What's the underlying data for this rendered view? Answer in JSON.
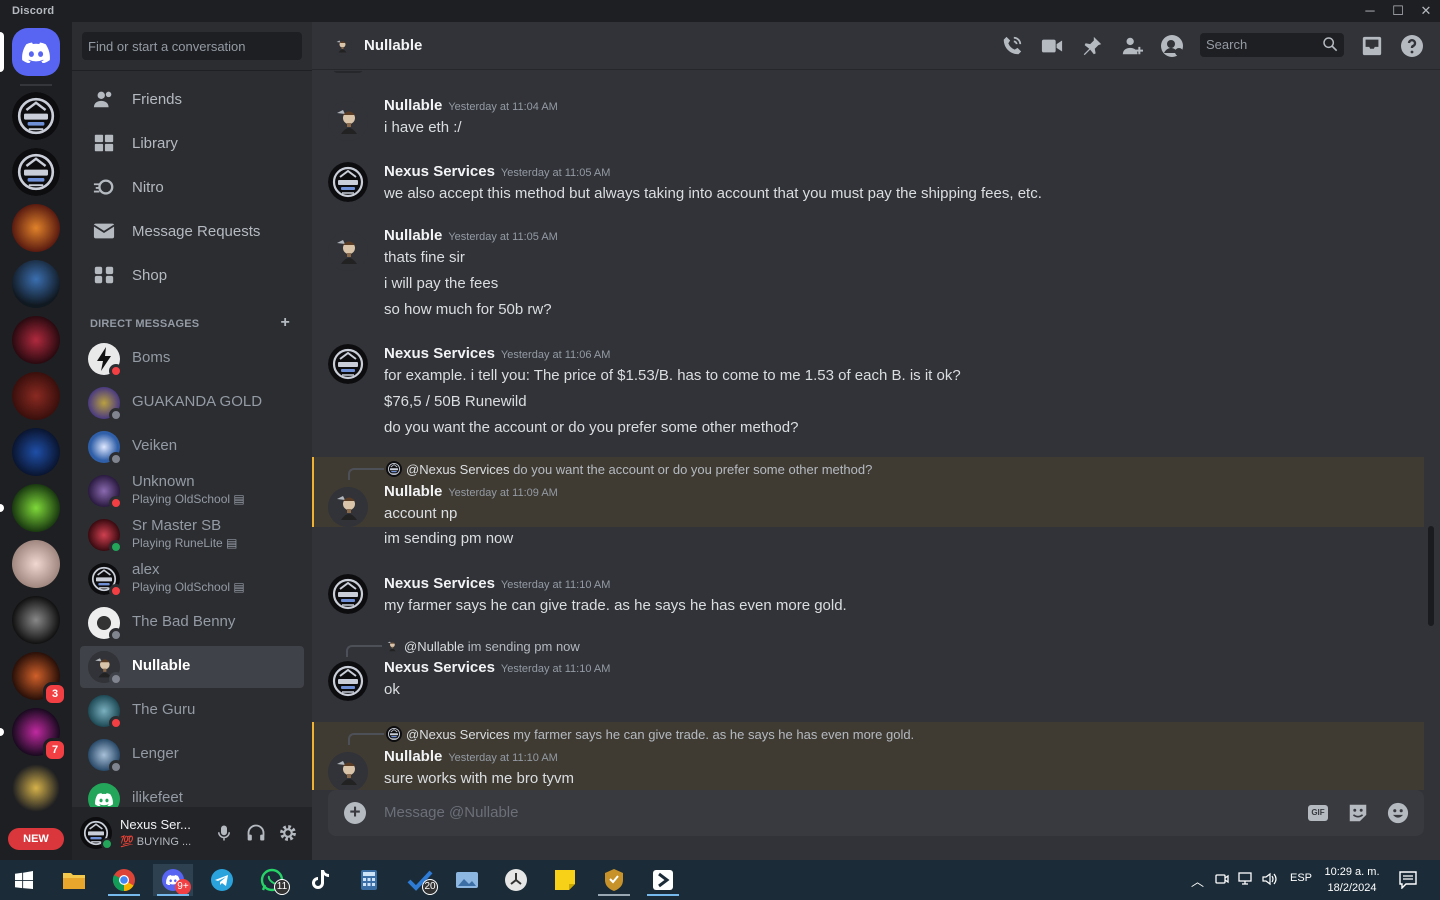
{
  "window": {
    "title": "Discord"
  },
  "search_placeholder": "Find or start a conversation",
  "nav": [
    {
      "label": "Friends",
      "icon": "friends-icon"
    },
    {
      "label": "Library",
      "icon": "library-icon"
    },
    {
      "label": "Nitro",
      "icon": "nitro-icon"
    },
    {
      "label": "Message Requests",
      "icon": "envelope-icon"
    },
    {
      "label": "Shop",
      "icon": "shop-icon"
    }
  ],
  "dm_header": "DIRECT MESSAGES",
  "dms": [
    {
      "name": "Boms",
      "status": "dnd",
      "avatar_color": "#d9dadc"
    },
    {
      "name": "GUAKANDA GOLD",
      "status": "offline",
      "avatar_color": "#6a5a9c"
    },
    {
      "name": "Veiken",
      "status": "offline",
      "avatar_color": "#2f5fa8"
    },
    {
      "name": "Unknown",
      "activity": "Playing OldSchool",
      "status": "dnd",
      "avatar_color": "#4b3a6b"
    },
    {
      "name": "Sr Master SB",
      "activity": "Playing RuneLite",
      "status": "online",
      "avatar_color": "#8a2530"
    },
    {
      "name": "alex",
      "activity": "Playing OldSchool",
      "status": "dnd",
      "avatar_color": "#3c3f55"
    },
    {
      "name": "The Bad Benny",
      "status": "offline",
      "avatar_color": "#e6e6e6"
    },
    {
      "name": "Nullable",
      "status": "offline",
      "avatar_color": "#3a3c42"
    },
    {
      "name": "The Guru",
      "status": "dnd",
      "avatar_color": "#2c5f6a"
    },
    {
      "name": "Lenger",
      "status": "offline",
      "avatar_color": "#4a6a8a"
    },
    {
      "name": "ilikefeet",
      "status": "offline",
      "avatar_color": "#23a55a"
    }
  ],
  "user": {
    "name": "Nexus Ser...",
    "status": "💯 BUYING ..."
  },
  "guild_badges": [
    "3",
    "7"
  ],
  "new_label": "NEW",
  "channel": {
    "name": "Nullable",
    "search": "Search"
  },
  "messages": [
    {
      "author": "Nullable",
      "time": "Yesterday at 11:04 AM",
      "lines": [
        "i have eth :/"
      ]
    },
    {
      "author": "Nexus Services",
      "time": "Yesterday at 11:05 AM",
      "lines": [
        "we also accept this method but always taking into account that you must pay the shipping fees, etc."
      ]
    },
    {
      "author": "Nullable",
      "time": "Yesterday at 11:05 AM",
      "lines": [
        "thats fine sir",
        "i will pay the fees",
        "so how much for 50b rw?"
      ]
    },
    {
      "author": "Nexus Services",
      "time": "Yesterday at 11:06 AM",
      "lines": [
        "for example. i tell you: The price of $1.53/B. has to come to me 1.53 of each B. is it ok?",
        "$76,5 / 50B Runewild",
        "do you want the account or do you prefer some other method?"
      ]
    },
    {
      "author": "Nullable",
      "time": "Yesterday at 11:09 AM",
      "reply_to": "@Nexus Services",
      "reply_text": "do you want the account or do you prefer some other method?",
      "lines": [
        "account np",
        "im sending pm now"
      ]
    },
    {
      "author": "Nexus Services",
      "time": "Yesterday at 11:10 AM",
      "lines": [
        "my farmer says he can give trade. as he says he has even more gold."
      ]
    },
    {
      "author": "Nexus Services",
      "time": "Yesterday at 11:10 AM",
      "reply_to": "@Nullable",
      "reply_text": "im sending pm now",
      "lines": [
        "ok"
      ]
    },
    {
      "author": "Nullable",
      "time": "Yesterday at 11:10 AM",
      "reply_to": "@Nexus Services",
      "reply_text": "my farmer says he can give trade. as he says he has even more gold.",
      "lines": [
        "sure works with me bro tyvm"
      ]
    }
  ],
  "composer": {
    "placeholder": "Message @Nullable",
    "gif": "GIF"
  },
  "taskbar": {
    "badges": {
      "chat": "9+",
      "whatsapp": "11",
      "todo": "20"
    },
    "lang": "ESP",
    "time": "10:29 a. m.",
    "date": "18/2/2024"
  },
  "colors": {
    "accent": "#5865f2",
    "dnd": "#f23f43",
    "online": "#23a55a",
    "offline": "#80848e",
    "mention_bg": "#3f3b33",
    "mention_bar": "#f0b232"
  }
}
